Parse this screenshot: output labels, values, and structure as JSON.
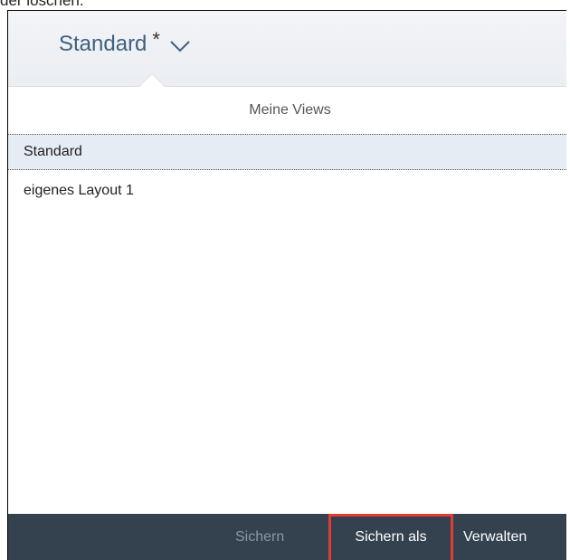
{
  "top_text": "der löschen.",
  "header": {
    "title": "Standard",
    "modified_marker": "*"
  },
  "section": {
    "title": "Meine Views"
  },
  "views": [
    {
      "label": "Standard",
      "selected": true
    },
    {
      "label": "eigenes Layout 1",
      "selected": false
    }
  ],
  "footer": {
    "save_label": "Sichern",
    "save_as_label": "Sichern als",
    "manage_label": "Verwalten"
  },
  "colors": {
    "title": "#3f5f80",
    "footer_bg": "#34414e",
    "highlight_border": "#e03c31",
    "selected_row_bg": "#e5ecf3"
  }
}
